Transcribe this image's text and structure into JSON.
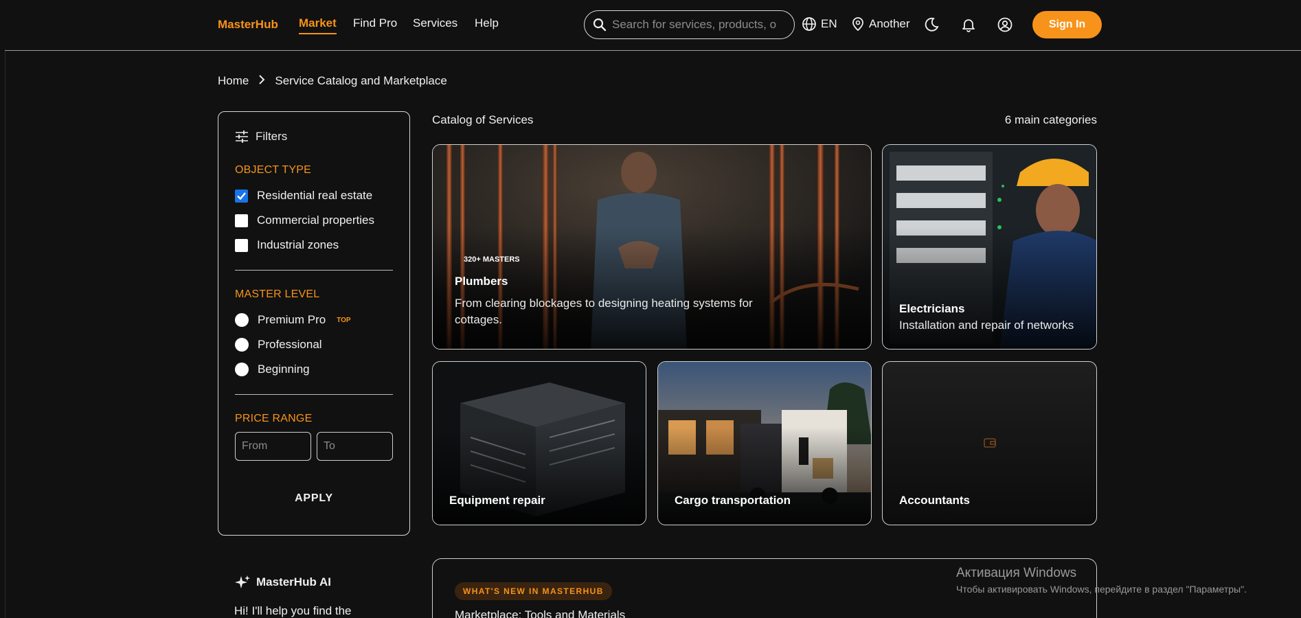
{
  "header": {
    "logo": "MasterHub",
    "nav": [
      "Market",
      "Find Pro",
      "Services",
      "Help"
    ],
    "search_placeholder": "Search for services, products, o",
    "language": "EN",
    "location": "Another",
    "sign_in": "Sign In",
    "accent": "#f7931a"
  },
  "breadcrumb": [
    "Home",
    "Service Catalog and Marketplace"
  ],
  "filters": {
    "title": "Filters",
    "object_type": {
      "title": "OBJECT TYPE",
      "options": [
        {
          "label": "Residential real estate",
          "checked": true
        },
        {
          "label": "Commercial properties",
          "checked": false
        },
        {
          "label": "Industrial zones",
          "checked": false
        }
      ]
    },
    "master_level": {
      "title": "MASTER LEVEL",
      "options": [
        {
          "label": "Premium Pro",
          "badge": "TOP"
        },
        {
          "label": "Professional"
        },
        {
          "label": "Beginning"
        }
      ]
    },
    "price_range": {
      "title": "PRICE RANGE",
      "from_placeholder": "From",
      "to_placeholder": "To"
    },
    "apply": "APPLY"
  },
  "catalog": {
    "title": "Catalog of Services",
    "count": "6 main categories",
    "cards": [
      {
        "name": "Plumbers",
        "badge": "320+ MASTERS",
        "desc": "From clearing blockages to designing heating systems for cottages."
      },
      {
        "name": "Electricians",
        "desc": "Installation and repair of networks"
      },
      {
        "name": "Equipment repair"
      },
      {
        "name": "Cargo transportation"
      },
      {
        "name": "Accountants"
      }
    ]
  },
  "ai": {
    "title": "MasterHub AI",
    "text": "Hi! I'll help you find the"
  },
  "news": {
    "badge": "WHAT'S NEW IN MASTERHUB",
    "title": "Marketplace: Tools and Materials"
  },
  "windows_activation": {
    "title": "Активация Windows",
    "text": "Чтобы активировать Windows, перейдите в раздел \"Параметры\"."
  }
}
